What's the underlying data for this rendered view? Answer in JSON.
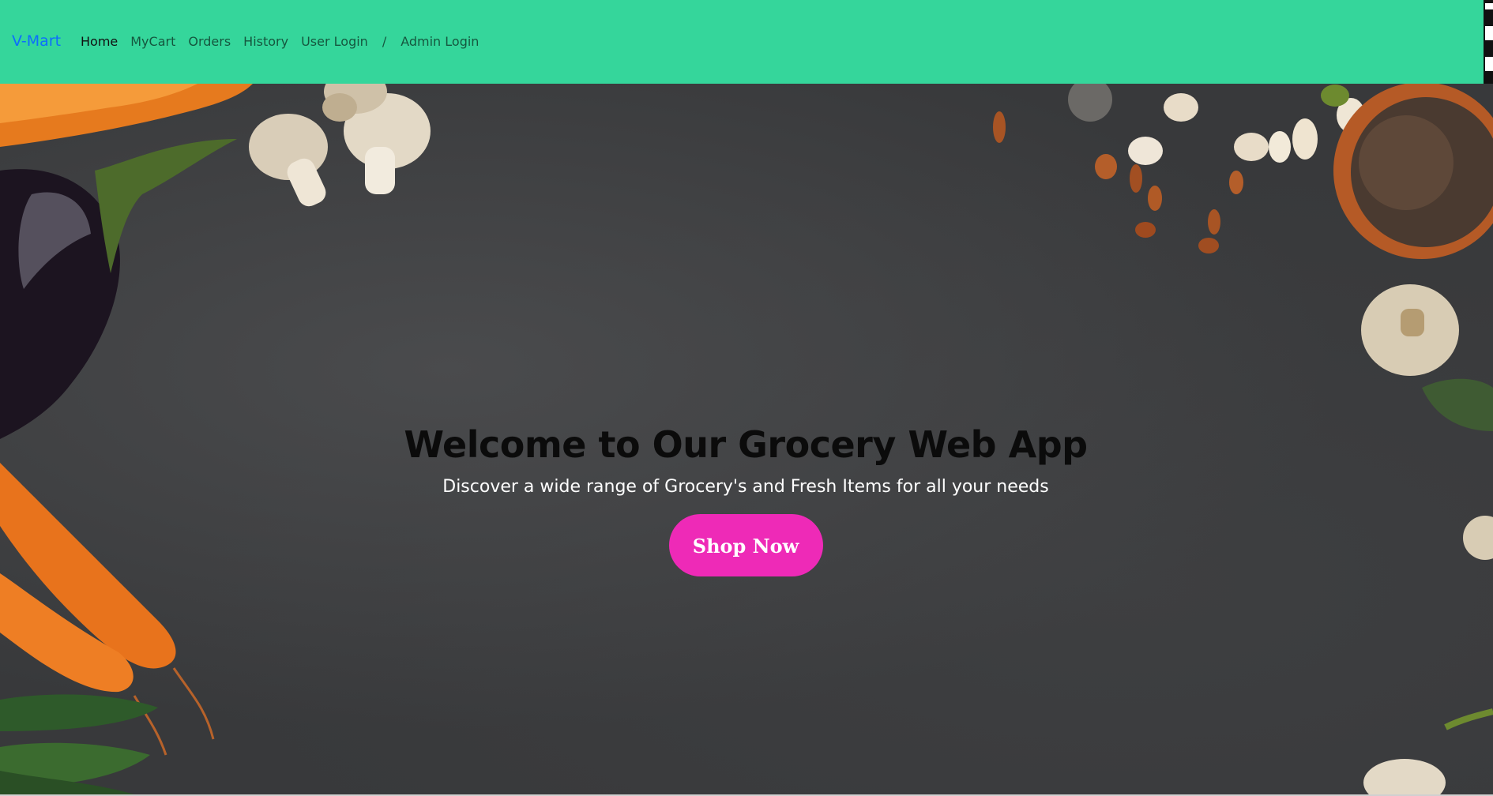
{
  "navbar": {
    "brand": "V-Mart",
    "links": [
      {
        "label": "Home",
        "active": true
      },
      {
        "label": "MyCart"
      },
      {
        "label": "Orders"
      },
      {
        "label": "History"
      },
      {
        "label": "User Login"
      }
    ],
    "separator": "/",
    "admin_login": "Admin Login"
  },
  "hero": {
    "title": "Welcome to Our Grocery Web App",
    "subtitle": "Discover a wide range of Grocery's and Fresh Items for all your needs",
    "button_label": "Shop Now"
  },
  "colors": {
    "nav_bg": "#35d69b",
    "brand": "#0d6efd",
    "button_bg": "#ee2ab7",
    "hero_bg": "#38393b"
  },
  "icons": [
    "mushroom-icon",
    "carrot-icon",
    "eggplant-icon",
    "spice-bowl-icon",
    "beans-icon"
  ]
}
